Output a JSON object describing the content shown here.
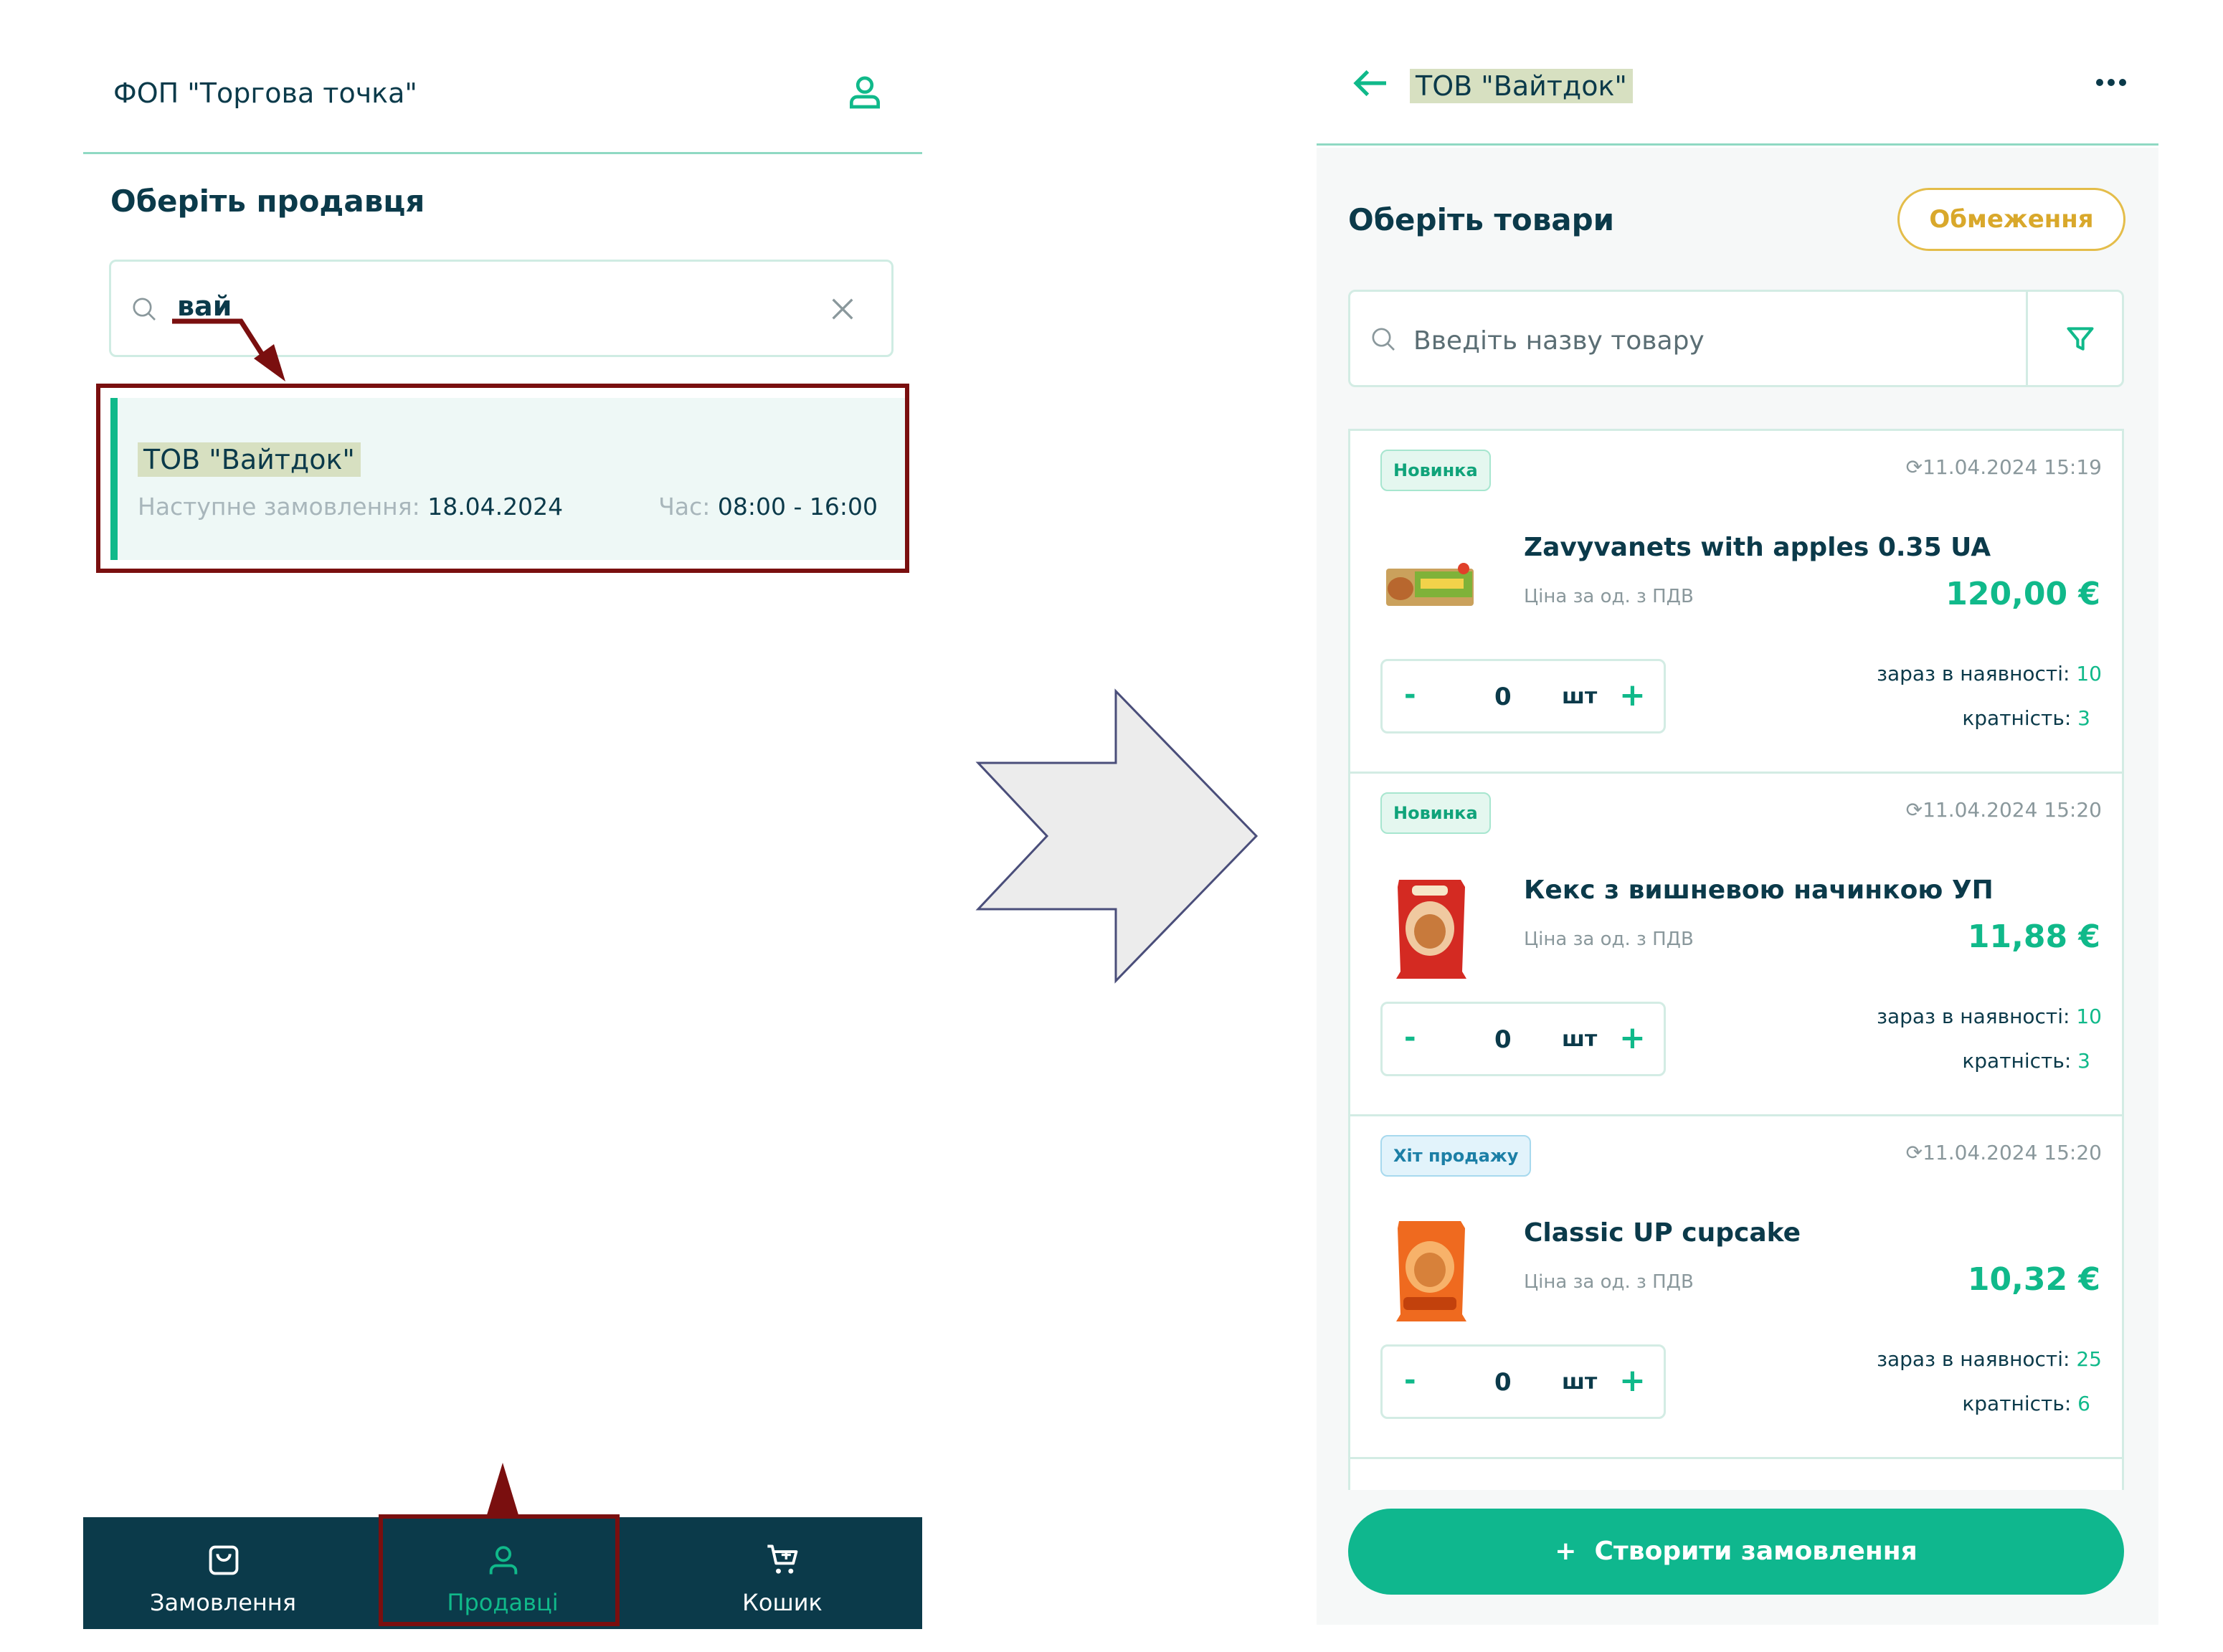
{
  "left": {
    "header_title": "ФОП \"Торгова точка\"",
    "heading": "Оберіть продавця",
    "search_value": "вай",
    "seller": {
      "name": "ТОВ \"Вайтдок\"",
      "next_order_label": "Наступне замовлення:",
      "next_order_date": "18.04.2024",
      "time_label": "Час:",
      "time_value": "08:00 - 16:00"
    },
    "nav": {
      "orders": "Замовлення",
      "sellers": "Продавці",
      "cart": "Кошик"
    }
  },
  "right": {
    "title": "ТОВ \"Вайтдок\"",
    "heading": "Оберіть товари",
    "limits_button": "Обмеження",
    "search_placeholder": "Введіть назву товару",
    "products": [
      {
        "badge": "Новинка",
        "timestamp": "11.04.2024 15:19",
        "name": "Zavyvanets with apples 0.35 UA",
        "price_label": "Ціна за од. з ПДВ",
        "price": "120,00 €",
        "quantity": "0",
        "unit": "шт",
        "stock_label": "зараз в наявності:",
        "stock_value": "10",
        "multiplicity_label": "кратність:",
        "multiplicity_value": "3"
      },
      {
        "badge": "Новинка",
        "timestamp": "11.04.2024 15:20",
        "name": "Кекс з вишневою начинкою УП",
        "price_label": "Ціна за од. з ПДВ",
        "price": "11,88 €",
        "quantity": "0",
        "unit": "шт",
        "stock_label": "зараз в наявності:",
        "stock_value": "10",
        "multiplicity_label": "кратність:",
        "multiplicity_value": "3"
      },
      {
        "badge": "Хіт продажу",
        "timestamp": "11.04.2024 15:20",
        "name": "Classic UP cupcake",
        "price_label": "Ціна за од. з ПДВ",
        "price": "10,32 €",
        "quantity": "0",
        "unit": "шт",
        "stock_label": "зараз в наявності:",
        "stock_value": "25",
        "multiplicity_label": "кратність:",
        "multiplicity_value": "6"
      }
    ],
    "create_button": "Створити замовлення",
    "stepper_minus": "-",
    "stepper_plus": "+",
    "create_plus": "+"
  },
  "colors": {
    "brand_green": "#10b98a",
    "dark_navy": "#0b3a4a",
    "annotation_red": "#7a0f0f",
    "limits_gold": "#d9a82b"
  }
}
